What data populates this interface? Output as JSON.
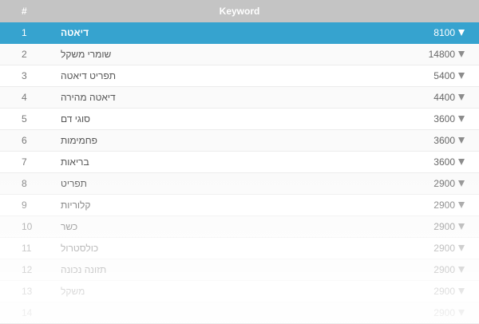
{
  "header": {
    "num_label": "#",
    "keyword_label": "Keyword"
  },
  "colors": {
    "header_bg": "#c4c4c4",
    "selected_bg": "#36a3cf"
  },
  "rows": [
    {
      "n": "1",
      "keyword": "דיאטה",
      "volume": "8100"
    },
    {
      "n": "2",
      "keyword": "שומרי משקל",
      "volume": "14800"
    },
    {
      "n": "3",
      "keyword": "תפריט דיאטה",
      "volume": "5400"
    },
    {
      "n": "4",
      "keyword": "דיאטה מהירה",
      "volume": "4400"
    },
    {
      "n": "5",
      "keyword": "סוגי דם",
      "volume": "3600"
    },
    {
      "n": "6",
      "keyword": "פחמימות",
      "volume": "3600"
    },
    {
      "n": "7",
      "keyword": "בריאות",
      "volume": "3600"
    },
    {
      "n": "8",
      "keyword": "תפריט",
      "volume": "2900"
    },
    {
      "n": "9",
      "keyword": "קלוריות",
      "volume": "2900"
    },
    {
      "n": "10",
      "keyword": "כשר",
      "volume": "2900"
    },
    {
      "n": "11",
      "keyword": "כולסטרול",
      "volume": "2900"
    },
    {
      "n": "12",
      "keyword": "תזונה נכונה",
      "volume": "2900"
    },
    {
      "n": "13",
      "keyword": "משקל",
      "volume": "2900"
    },
    {
      "n": "14",
      "keyword": "",
      "volume": "2900"
    }
  ],
  "selected_row": "1",
  "icons": {
    "row_arrow": "caret-down-icon"
  }
}
